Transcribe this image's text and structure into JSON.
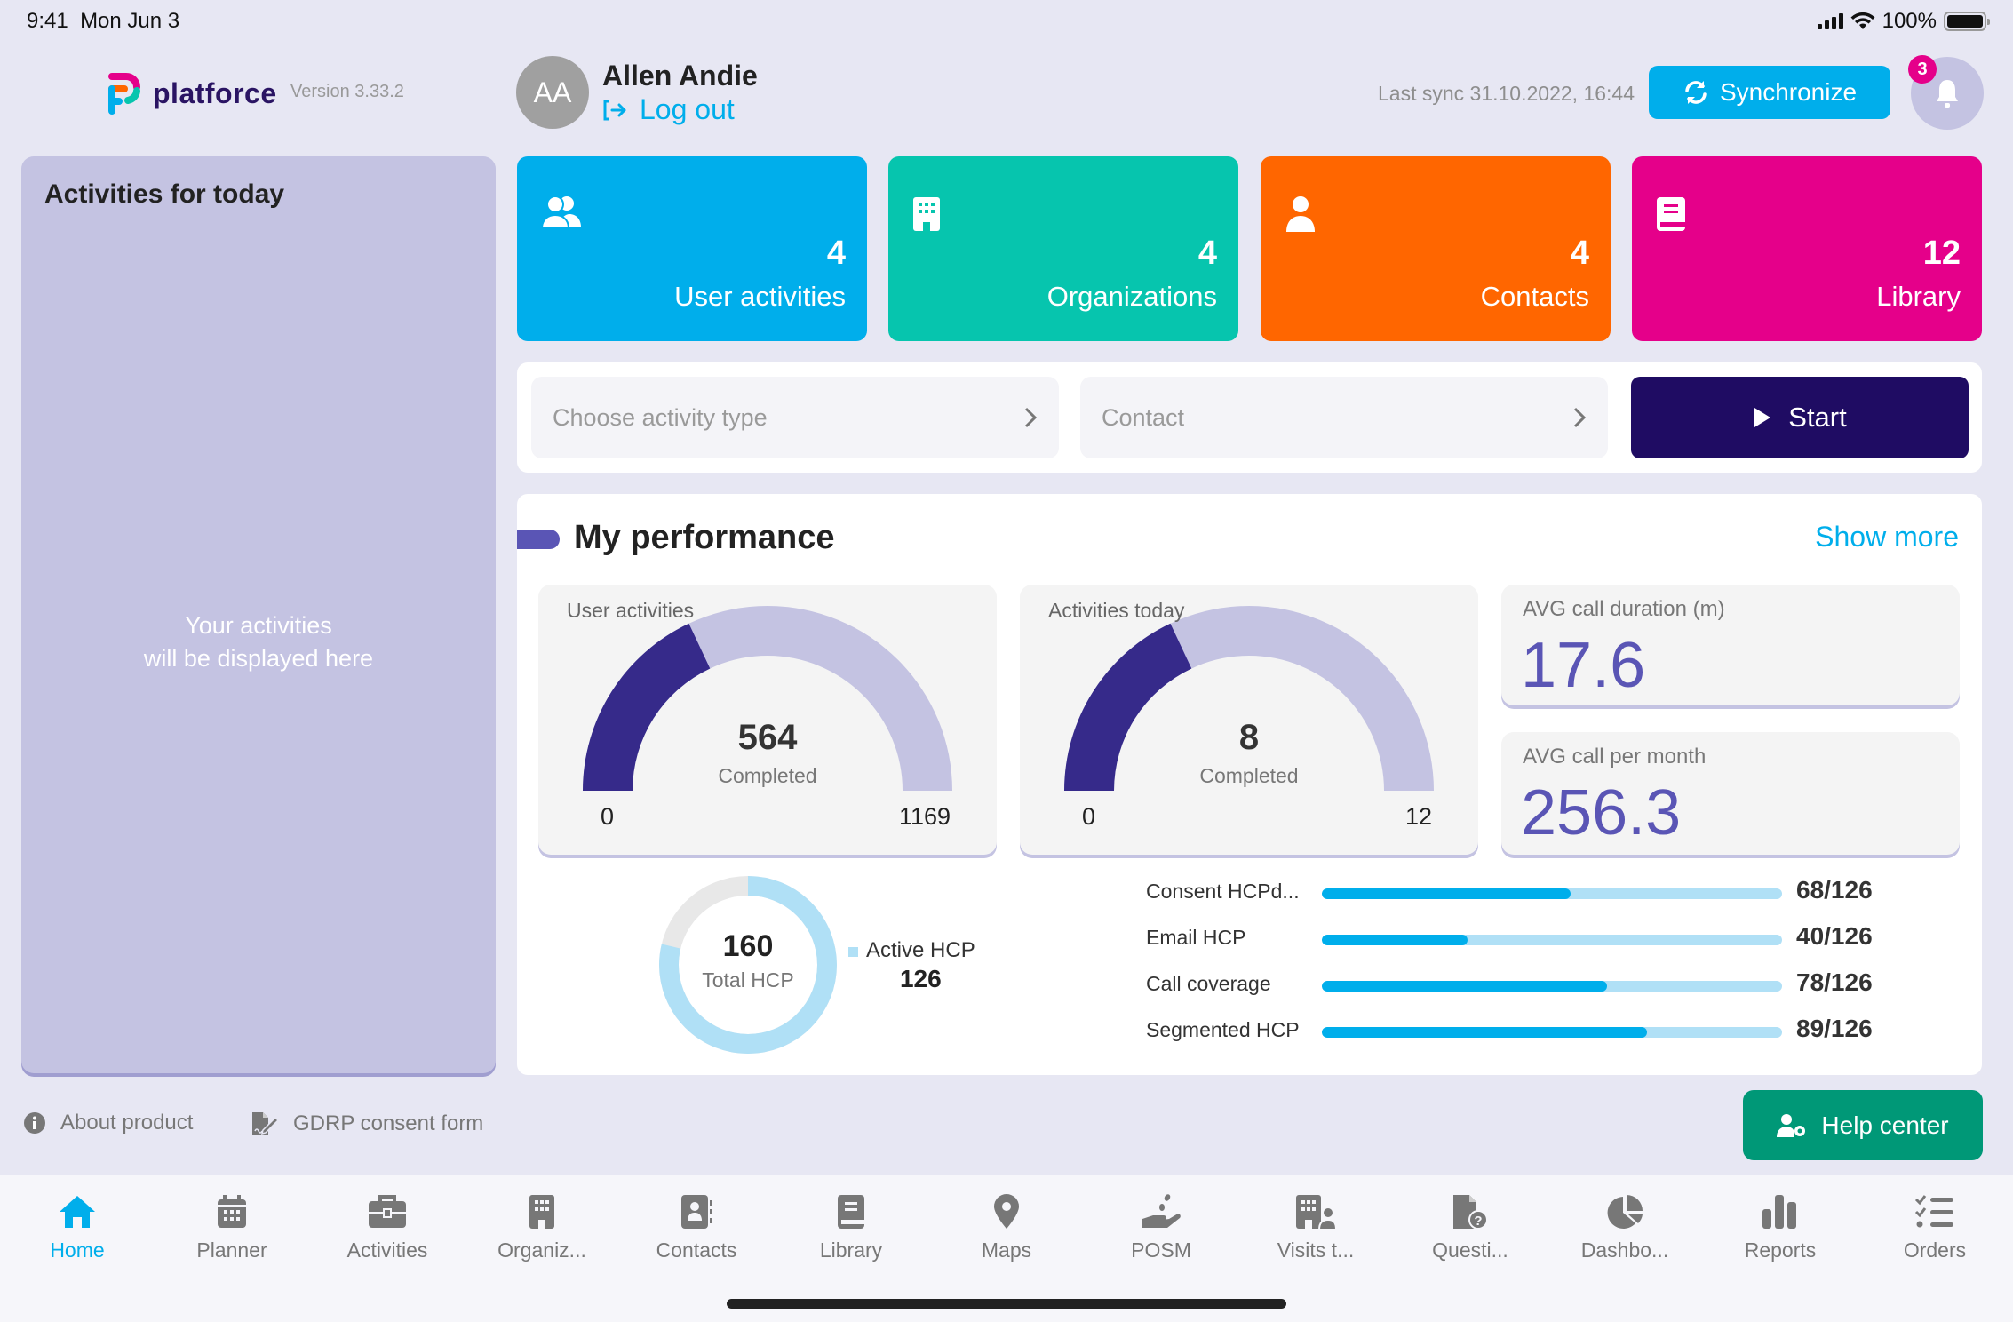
{
  "status_bar": {
    "time": "9:41",
    "date": "Mon Jun 3",
    "battery": "100%"
  },
  "header": {
    "logo_text": "platforce",
    "version": "Version 3.33.2",
    "user": {
      "initials": "AA",
      "name": "Allen Andie",
      "logout_label": "Log out"
    },
    "last_sync": "Last sync 31.10.2022, 16:44",
    "sync_label": "Synchronize",
    "notification_count": "3"
  },
  "left_panel": {
    "title": "Activities for today",
    "empty_line1": "Your activities",
    "empty_line2": "will be displayed here"
  },
  "tiles": [
    {
      "count": "4",
      "label": "User activities",
      "icon": "users-icon",
      "color": "#00AEEB"
    },
    {
      "count": "4",
      "label": "Organizations",
      "icon": "building-icon",
      "color": "#06C5AE"
    },
    {
      "count": "4",
      "label": "Contacts",
      "icon": "user-icon",
      "color": "#FF6600"
    },
    {
      "count": "12",
      "label": "Library",
      "icon": "book-icon",
      "color": "#E5008A"
    }
  ],
  "activity_form": {
    "activity_type_placeholder": "Choose activity type",
    "contact_placeholder": "Contact",
    "start_label": "Start"
  },
  "performance": {
    "title": "My performance",
    "show_more": "Show more",
    "gauges": [
      {
        "title": "User activities",
        "value": "564",
        "sub": "Completed",
        "min": "0",
        "max": "1169",
        "fill_fraction": 0.36
      },
      {
        "title": "Activities today",
        "value": "8",
        "sub": "Completed",
        "min": "0",
        "max": "12",
        "fill_fraction": 0.36
      }
    ],
    "stats": [
      {
        "title": "AVG call duration (m)",
        "value": "17.6"
      },
      {
        "title": "AVG call per month",
        "value": "256.3"
      }
    ],
    "donut": {
      "total": "160",
      "total_label": "Total HCP",
      "active_label": "Active HCP",
      "active": "126",
      "active_value": 126,
      "total_value": 160
    },
    "bars": [
      {
        "label": "Consent HCPd...",
        "value": 68,
        "total": 126,
        "display": "68/126"
      },
      {
        "label": "Email HCP",
        "value": 40,
        "total": 126,
        "display": "40/126"
      },
      {
        "label": "Call coverage",
        "value": 78,
        "total": 126,
        "display": "78/126"
      },
      {
        "label": "Segmented HCP",
        "value": 89,
        "total": 126,
        "display": "89/126"
      }
    ]
  },
  "footer": {
    "about_label": "About product",
    "gdpr_label": "GDRP consent form",
    "help_label": "Help center"
  },
  "colors": {
    "accent": "#00AEEB",
    "primary_dark": "#1F0C63",
    "gauge_fill": "#362A8A",
    "gauge_track": "#C4C3E2",
    "stat_value": "#5A55B5",
    "help_green": "#009877"
  },
  "bottom_nav": [
    {
      "label": "Home",
      "icon": "home-icon",
      "active": true
    },
    {
      "label": "Planner",
      "icon": "calendar-icon"
    },
    {
      "label": "Activities",
      "icon": "briefcase-icon"
    },
    {
      "label": "Organiz...",
      "icon": "building-icon"
    },
    {
      "label": "Contacts",
      "icon": "contact-card-icon"
    },
    {
      "label": "Library",
      "icon": "book-icon"
    },
    {
      "label": "Maps",
      "icon": "map-pin-icon"
    },
    {
      "label": "POSM",
      "icon": "hand-coins-icon"
    },
    {
      "label": "Visits t...",
      "icon": "building-user-icon"
    },
    {
      "label": "Questi...",
      "icon": "file-question-icon"
    },
    {
      "label": "Dashbo...",
      "icon": "pie-chart-icon"
    },
    {
      "label": "Reports",
      "icon": "bar-chart-icon"
    },
    {
      "label": "Orders",
      "icon": "checklist-icon"
    }
  ]
}
